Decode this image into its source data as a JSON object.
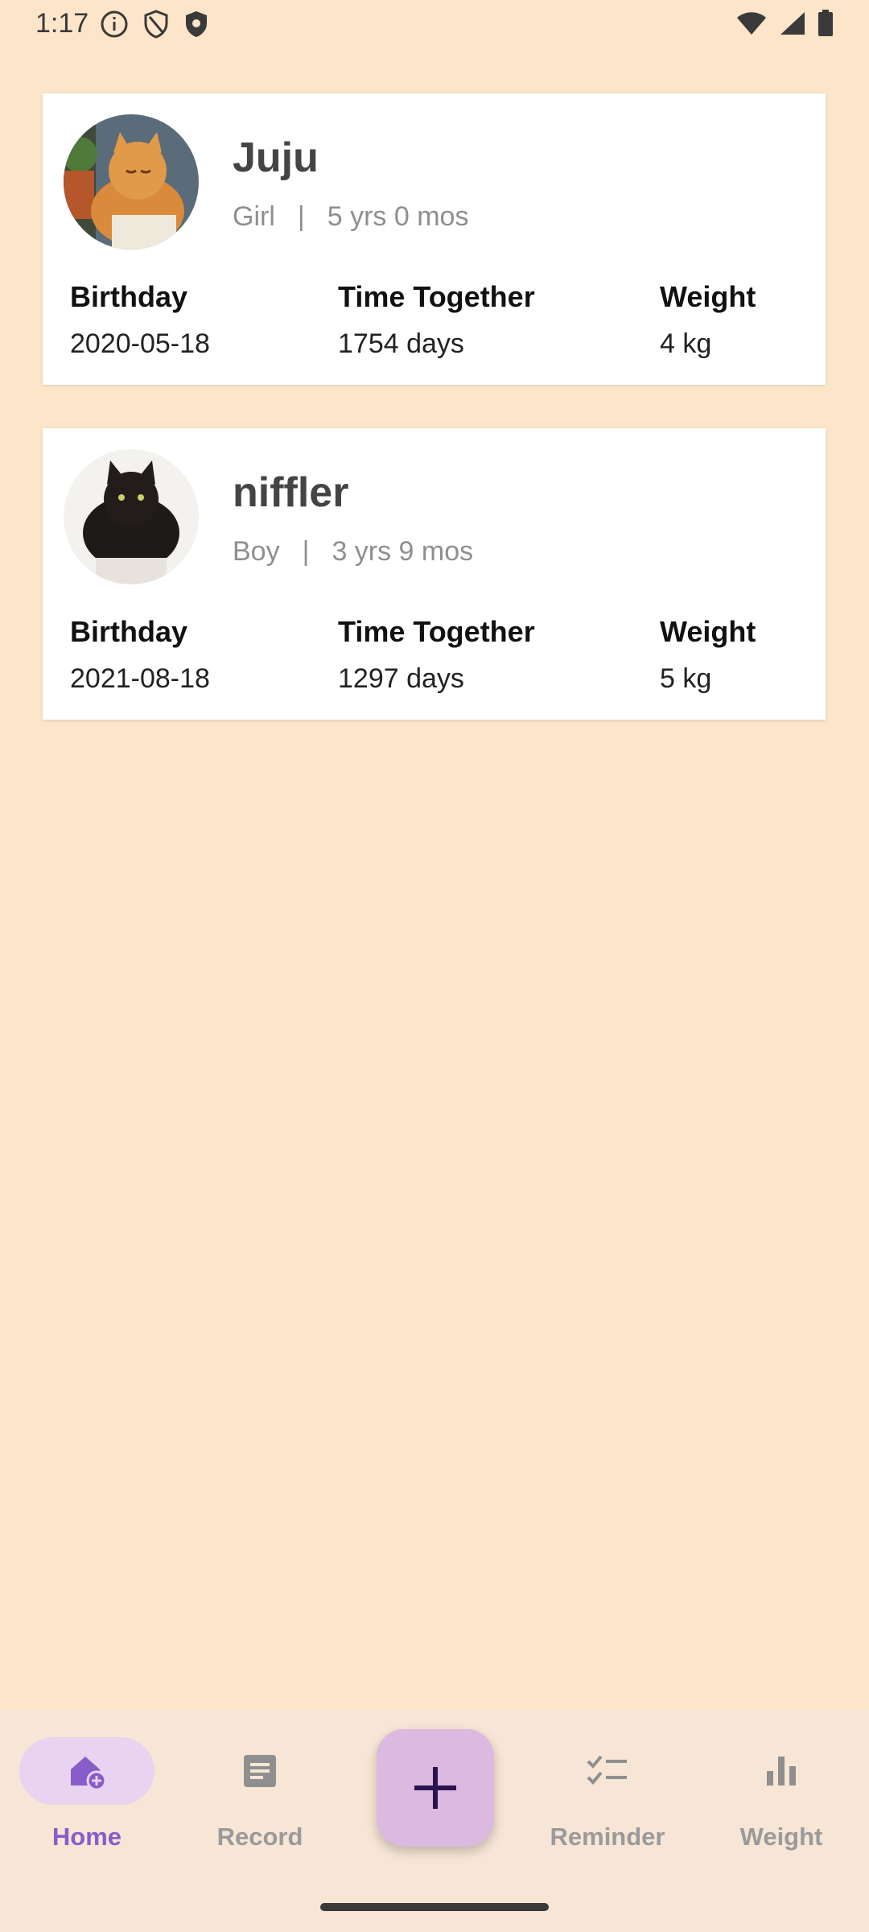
{
  "status_bar": {
    "time": "1:17",
    "left_icons": [
      "info-icon",
      "shield-icon",
      "shield-filled-icon"
    ],
    "right_icons": [
      "wifi-icon",
      "cellular-icon",
      "battery-icon"
    ]
  },
  "pets": [
    {
      "name": "Juju",
      "gender": "Girl",
      "separator": "|",
      "age": "5 yrs 0 mos",
      "avatar": "orange-cat-photo",
      "labels": {
        "birthday": "Birthday",
        "time_together": "Time Together",
        "weight": "Weight"
      },
      "birthday": "2020-05-18",
      "time_together": "1754 days",
      "weight": "4  kg"
    },
    {
      "name": "niffler",
      "gender": "Boy",
      "separator": "|",
      "age": "3 yrs 9 mos",
      "avatar": "black-cat-photo",
      "labels": {
        "birthday": "Birthday",
        "time_together": "Time Together",
        "weight": "Weight"
      },
      "birthday": "2021-08-18",
      "time_together": "1297 days",
      "weight": "5  kg"
    }
  ],
  "bottom_nav": {
    "items": [
      {
        "label": "Home",
        "icon": "home-add-icon",
        "active": true
      },
      {
        "label": "Record",
        "icon": "document-icon",
        "active": false
      },
      {
        "label": "Reminder",
        "icon": "checklist-icon",
        "active": false
      },
      {
        "label": "Weight",
        "icon": "bar-chart-icon",
        "active": false
      }
    ],
    "fab_icon": "plus-icon"
  },
  "colors": {
    "background": "#FDE5C9",
    "card": "#FFFFFF",
    "nav_background": "#F7E6D5",
    "accent": "#8A5CC9",
    "active_pill": "#E8D3F0",
    "fab": "#DCB9E0"
  }
}
